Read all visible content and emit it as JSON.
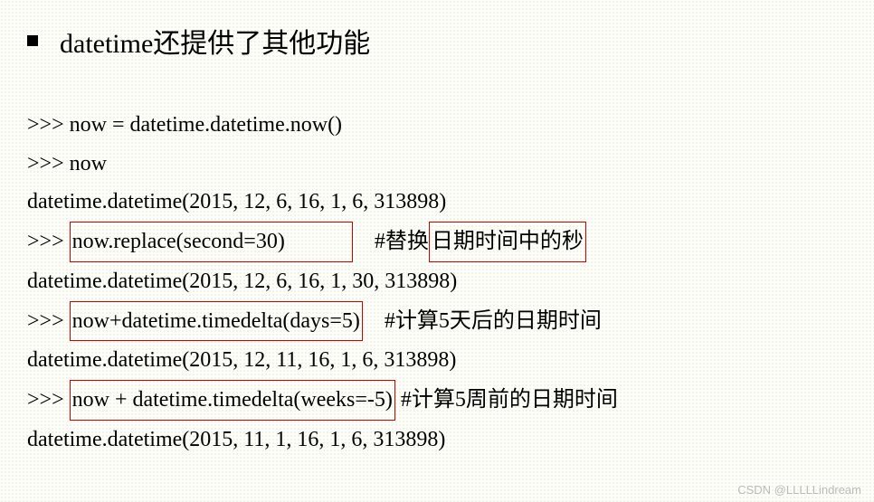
{
  "heading": {
    "text": "datetime还提供了其他功能"
  },
  "code": {
    "line1": ">>> now = datetime.datetime.now()",
    "line2": ">>> now",
    "line3": "datetime.datetime(2015, 12, 6, 16, 1, 6, 313898)",
    "line4_prefix": ">>> ",
    "line4_box": "now.replace(second=30)            ",
    "line4_suffix": "    #替换",
    "line4_box2": "日期时间中的秒",
    "line5": "datetime.datetime(2015, 12, 6, 16, 1, 30, 313898)",
    "line6_prefix": ">>> ",
    "line6_box": "now+datetime.timedelta(days=5)",
    "line6_suffix": "    #计算5天后的日期时间",
    "line7": "datetime.datetime(2015, 12, 11, 16, 1, 6, 313898)",
    "line8_prefix": ">>> ",
    "line8_box": "now + datetime.timedelta(weeks=-5)",
    "line8_suffix": " #计算5周前的日期时间",
    "line9": "datetime.datetime(2015, 11, 1, 16, 1, 6, 313898)"
  },
  "watermark": "CSDN @LLLLLindream"
}
